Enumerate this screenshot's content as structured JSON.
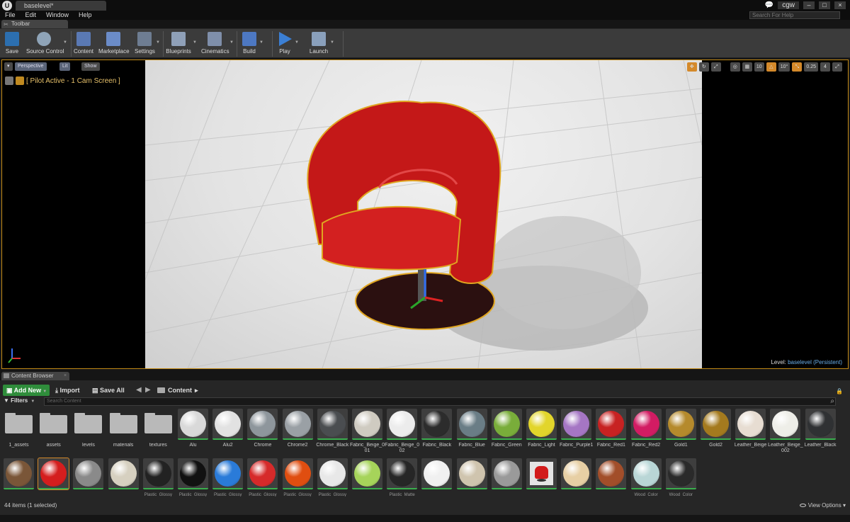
{
  "window": {
    "tab_title": "baselevel*",
    "user": "cgw",
    "search_help_placeholder": "Search For Help"
  },
  "menu": [
    "File",
    "Edit",
    "Window",
    "Help"
  ],
  "toolbar": {
    "tab_label": "Toolbar",
    "buttons": [
      {
        "label": "Save"
      },
      {
        "label": "Source Control"
      },
      {
        "label": "Content"
      },
      {
        "label": "Marketplace"
      },
      {
        "label": "Settings"
      },
      {
        "label": "Blueprints"
      },
      {
        "label": "Cinematics"
      },
      {
        "label": "Build"
      },
      {
        "label": "Play"
      },
      {
        "label": "Launch"
      }
    ]
  },
  "viewport": {
    "perspective_label": "Perspective",
    "lit_label": "Lit",
    "show_label": "Show",
    "pilot_text": "[ Pilot Active - 1 Cam Screen ]",
    "grid_snap": "10",
    "rotation_snap": "10°",
    "scale_snap": "0.25",
    "camera_speed": "4",
    "level_prefix": "Level:",
    "level_name": "baselevel (Persistent)"
  },
  "content_browser": {
    "tab_label": "Content Browser",
    "add_new_label": "Add New",
    "import_label": "Import",
    "save_all_label": "Save All",
    "breadcrumb": "Content",
    "filters_label": "Filters",
    "search_placeholder": "Search Content",
    "items_status": "44 items (1 selected)",
    "view_options_label": "View Options",
    "folders": [
      "1_assets",
      "assets",
      "levels",
      "materials",
      "textures"
    ],
    "row1_assets": [
      "Alu",
      "Alu2",
      "Chrome",
      "Chrome2",
      "Chrome_Black",
      "Fabric_Beige_001",
      "Fabric_Beige_002",
      "Fabric_Black",
      "Fabric_Blue",
      "Fabric_Green",
      "Fabric_Light",
      "Fabric_Purple1",
      "Fabric_Red1",
      "Fabric_Red2",
      "Gold1",
      "Gold2",
      "Leather_Beige",
      "Leather_Beige_002",
      "Leather_Black"
    ],
    "row2_assets": [
      "",
      "",
      "",
      "",
      "Plastic_Glossy",
      "Plastic_Glossy",
      "Plastic_Glossy",
      "Plastic_Glossy",
      "Plastic_Glossy",
      "Plastic_Glossy",
      "",
      "Plastic_Matte",
      "",
      "",
      "",
      "",
      "",
      "",
      "Wood_Color",
      "Wood_Color"
    ],
    "row1_colors": [
      "#d9d9d9",
      "#e2e2e2",
      "#8e969c",
      "#9aa0a5",
      "#4a4d50",
      "#cfcbc1",
      "#ececec",
      "#2c2c2c",
      "#6a7d86",
      "#79ad3a",
      "#e2d52b",
      "#a576c4",
      "#c72222",
      "#d21c63",
      "#b58a2c",
      "#a47a1e",
      "#e7ddd2",
      "#eeeee8",
      "#2f3133"
    ],
    "row2_colors": [
      "#7a5638",
      "#d41e1e",
      "#8a8a8a",
      "#d6d0c0",
      "#222222",
      "#111111",
      "#2a7bd9",
      "#d62a2a",
      "#e04e10",
      "#e8e8e8",
      "#a6d45a",
      "#262626",
      "#f0f0f0",
      "#cfc4ae",
      "#9a9a9a",
      "",
      "#e7cfa4",
      "#a24e2a",
      "#b9d6d6",
      "#2a2a2a"
    ]
  }
}
